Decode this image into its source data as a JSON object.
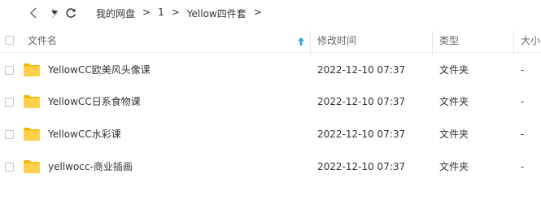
{
  "toolbar": {
    "back_icon": "chevron-left-icon",
    "forward_icon": "chevron-right-icon",
    "history_icon": "caret-down-icon",
    "refresh_icon": "refresh-icon"
  },
  "breadcrumb": {
    "items": [
      "我的网盘",
      "1",
      "Yellow四件套"
    ],
    "separator": ">"
  },
  "columns": {
    "name": "文件名",
    "modified": "修改时间",
    "type": "类型",
    "size": "大小"
  },
  "sort": {
    "column": "name",
    "direction": "asc",
    "icon": "arrow-up-icon",
    "color": "#1ea7e6"
  },
  "rows": [
    {
      "name": "YellowCC欧美风头像课",
      "modified": "2022-12-10 07:37",
      "type": "文件夹",
      "size": "-"
    },
    {
      "name": "YellowCC日系食物课",
      "modified": "2022-12-10 07:37",
      "type": "文件夹",
      "size": "-"
    },
    {
      "name": "YellowCC水彩课",
      "modified": "2022-12-10 07:37",
      "type": "文件夹",
      "size": "-"
    },
    {
      "name": "yellwocc-商业插画",
      "modified": "2022-12-10 07:37",
      "type": "文件夹",
      "size": "-"
    }
  ],
  "colors": {
    "folder": "#ffd04b",
    "folder_tab": "#f5b800"
  }
}
